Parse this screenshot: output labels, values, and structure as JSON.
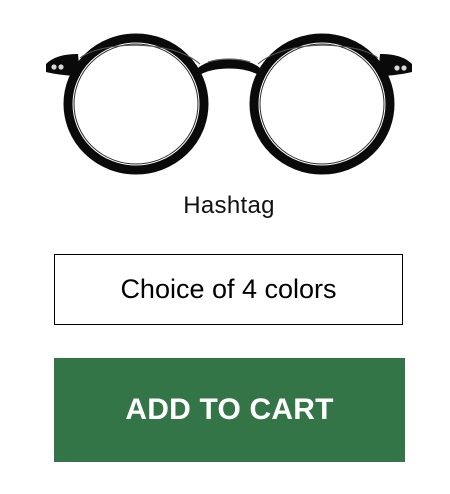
{
  "product": {
    "name": "Hashtag",
    "image_icon": "round-eyeglasses-image",
    "frame_color": "#0a0a0a"
  },
  "color_choice": {
    "label": "Choice of 4 colors"
  },
  "cart": {
    "button_label": "ADD TO CART",
    "button_color": "#347548"
  }
}
